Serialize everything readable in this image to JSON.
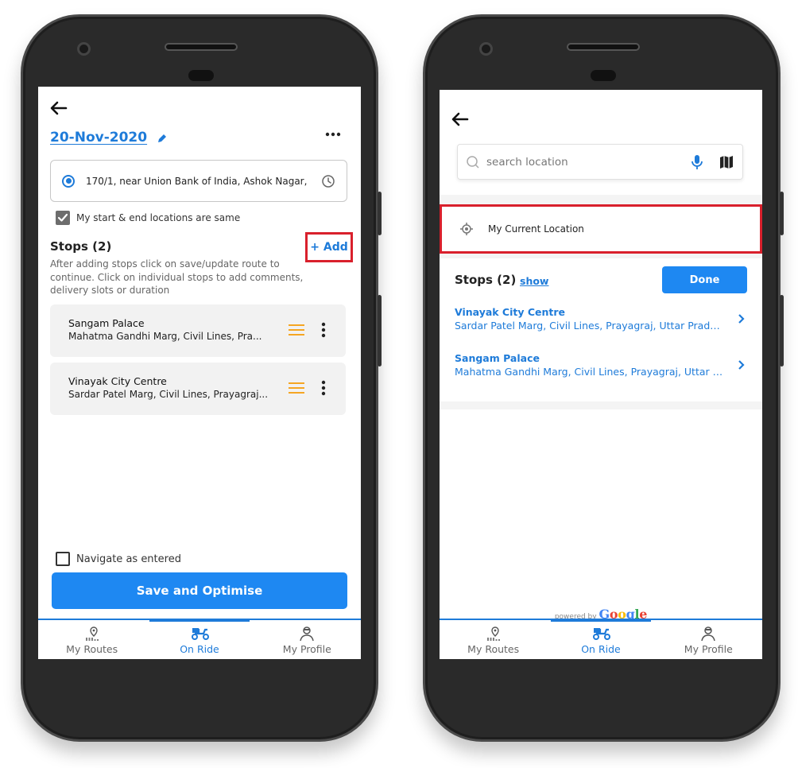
{
  "left_screen": {
    "date": "20-Nov-2020",
    "start_location": "170/1, near Union Bank of India, Ashok Nagar,",
    "same_locations_label": "My start & end locations are same",
    "stops_title": "Stops (2)",
    "add_label": "+ Add",
    "stops_description": "After adding stops click on save/update route to continue. Click on individual stops to add comments, delivery slots or duration",
    "stops": [
      {
        "name": "Sangam Palace",
        "address": "Mahatma Gandhi Marg, Civil Lines, Pra..."
      },
      {
        "name": "Vinayak City Centre",
        "address": "Sardar Patel Marg, Civil Lines, Prayagraj..."
      }
    ],
    "navigate_label": "Navigate as entered",
    "save_label": "Save and Optimise"
  },
  "right_screen": {
    "search_placeholder": "search location",
    "current_location_label": "My Current Location",
    "stops_title": "Stops (2)",
    "show_label": "show",
    "done_label": "Done",
    "stops": [
      {
        "name": "Vinayak City Centre",
        "address": "Sardar Patel Marg, Civil Lines, Prayagraj, Uttar Prade..."
      },
      {
        "name": "Sangam Palace",
        "address": "Mahatma Gandhi Marg, Civil Lines, Prayagraj, Uttar P..."
      }
    ],
    "powered_by": "powered by",
    "google_letters": [
      "G",
      "o",
      "o",
      "g",
      "l",
      "e"
    ]
  },
  "bottom_nav": {
    "items": [
      {
        "label": "My Routes",
        "icon": "route-pin-icon"
      },
      {
        "label": "On Ride",
        "icon": "scooter-icon"
      },
      {
        "label": "My Profile",
        "icon": "person-icon"
      }
    ],
    "active_index": 1
  },
  "colors": {
    "accent": "#1e88f2",
    "link": "#1e7bd9",
    "highlight": "#d9202c",
    "drag_icon": "#f5a623"
  }
}
